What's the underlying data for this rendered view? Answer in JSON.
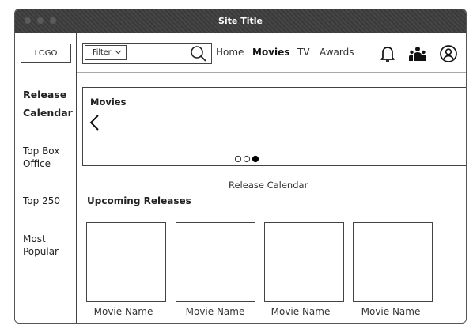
{
  "window": {
    "title": "Site Title"
  },
  "sidebar": {
    "logo": "LOGO",
    "items": [
      {
        "label": "Release\nCalendar",
        "active": true
      },
      {
        "label": "Top Box\nOffice",
        "active": false
      },
      {
        "label": "Top 250",
        "active": false
      },
      {
        "label": "Most\nPopular",
        "active": false
      }
    ]
  },
  "topbar": {
    "filter_label": "Filter",
    "filter_icon": "chevron-down-icon",
    "search_icon": "search-icon",
    "nav": [
      {
        "label": "Home",
        "active": false
      },
      {
        "label": "Movies",
        "active": true
      },
      {
        "label": "TV",
        "active": false
      },
      {
        "label": "Awards",
        "active": false
      }
    ],
    "icons": [
      "bell-icon",
      "group-icon",
      "user-icon"
    ]
  },
  "hero": {
    "label": "Movies",
    "carousel": {
      "pages": 3,
      "current_page": 3
    }
  },
  "main": {
    "caption": "Release Calendar",
    "section_title": "Upcoming Releases",
    "movies": [
      "Movie Name",
      "Movie Name",
      "Movie Name",
      "Movie Name"
    ]
  }
}
